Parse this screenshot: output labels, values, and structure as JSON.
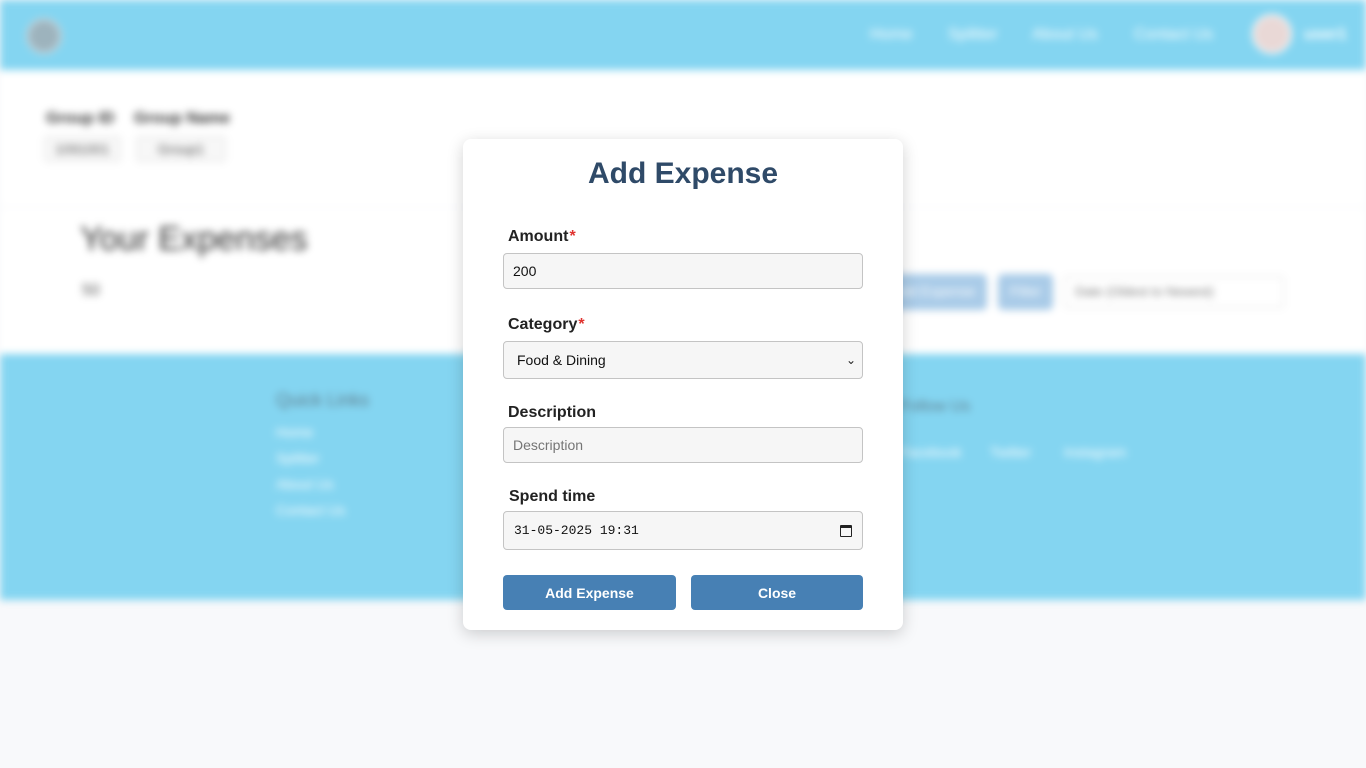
{
  "background": {
    "nav": {
      "links": [
        "Home",
        "Splitter",
        "About Us",
        "Contact Us"
      ],
      "user": "user1"
    },
    "group": {
      "id_header": "Group ID",
      "name_header": "Group Name",
      "id_value": "1091001",
      "name_value": "Group1"
    },
    "expenses": {
      "title": "Your Expenses",
      "total": "50",
      "add_button": "Add Expense",
      "filter_button": "Filter",
      "sort_select": "Date (Oldest to Newest)"
    },
    "footer": {
      "quick_links_title": "Quick Links",
      "quick_links": [
        "Home",
        "Splitter",
        "About Us",
        "Contact Us"
      ],
      "follow_title": "Follow Us",
      "social": [
        "Facebook",
        "Twitter",
        "Instagram"
      ]
    }
  },
  "modal": {
    "title": "Add Expense",
    "amount": {
      "label": "Amount",
      "required_mark": "*",
      "value": "200"
    },
    "category": {
      "label": "Category",
      "required_mark": "*",
      "selected": "Food & Dining"
    },
    "description": {
      "label": "Description",
      "placeholder": "Description"
    },
    "spend_time": {
      "label": "Spend time",
      "value": "31-05-2025 19:31"
    },
    "submit_label": "Add Expense",
    "close_label": "Close"
  },
  "colors": {
    "nav_bg": "#84d5f1",
    "modal_title": "#2f4a68",
    "button_bg": "#4780b4",
    "required": "#e0332f"
  }
}
